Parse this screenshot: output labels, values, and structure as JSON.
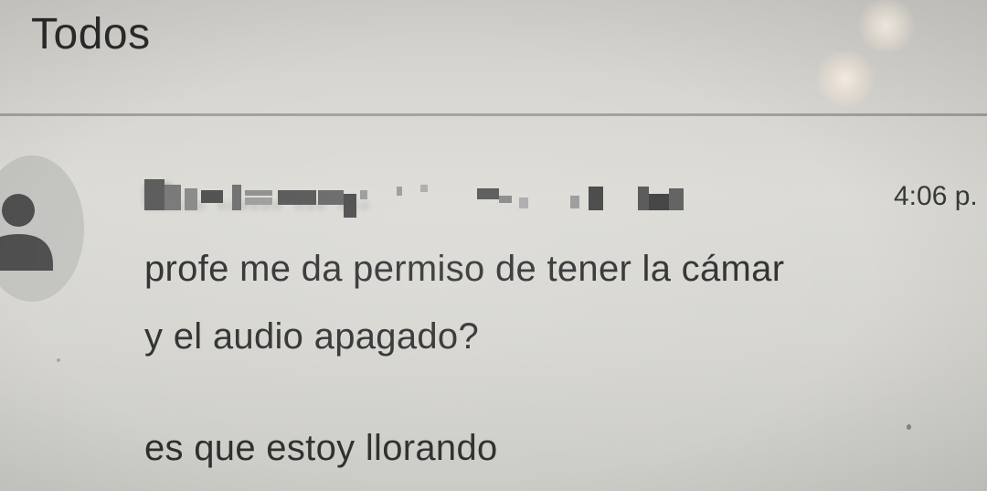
{
  "header": {
    "title": "Todos"
  },
  "message": {
    "sender_name": "M... ...... ... ...",
    "timestamp": "4:06 p.",
    "lines": [
      "profe me da permiso de tener la cámar",
      "y el audio apagado?",
      "es que estoy llorando"
    ],
    "avatar_icon": "person-icon"
  },
  "colors": {
    "background": "#d8d6d1",
    "text": "#2f2f2f",
    "divider": "#8f8f8c",
    "avatar_bg": "#c4c4c0",
    "avatar_icon": "#4f4f4f"
  }
}
